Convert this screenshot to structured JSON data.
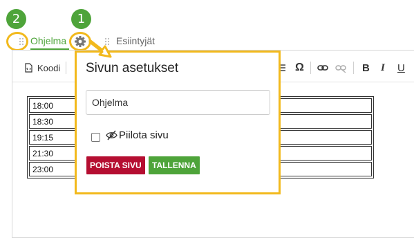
{
  "callouts": {
    "first": "1",
    "second": "2"
  },
  "tabs": [
    {
      "label": "Ohjelma",
      "active": true
    },
    {
      "label": "Esiintyjät",
      "active": false
    }
  ],
  "toolbar": {
    "code_label": "Koodi",
    "buttons": [
      "omega-icon",
      "link-icon",
      "unlink-icon",
      "bold-icon",
      "italic-icon",
      "underline-icon"
    ],
    "bold": "B",
    "italic": "I",
    "underline": "U",
    "omega": "Ω"
  },
  "schedule": {
    "rows": [
      {
        "time": "18:00",
        "text": ""
      },
      {
        "time": "18:30",
        "text": ""
      },
      {
        "time": "19:15",
        "text": ""
      },
      {
        "time": "21:30",
        "text": ""
      },
      {
        "time": "23:00",
        "text": ""
      }
    ]
  },
  "popup": {
    "title": "Sivun asetukset",
    "name_value": "Ohjelma",
    "hide_label": "Piilota sivu",
    "delete_label": "POISTA SIVU",
    "save_label": "TALLENNA"
  },
  "colors": {
    "accent_green": "#4ea43a",
    "highlight_yellow": "#f2b91c",
    "danger_red": "#b50e31"
  }
}
